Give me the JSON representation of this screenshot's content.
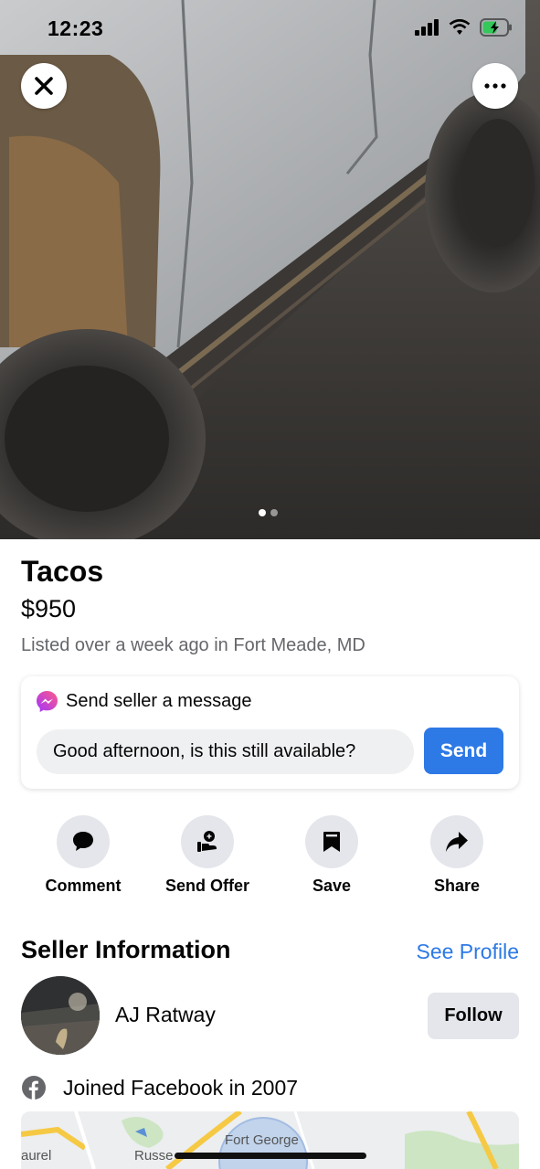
{
  "status": {
    "time": "12:23"
  },
  "listing": {
    "title": "Tacos",
    "price": "$950",
    "meta": "Listed over a week ago in Fort Meade, MD",
    "photo_count": 2,
    "photo_index": 1
  },
  "message": {
    "heading": "Send seller a message",
    "input_value": "Good afternoon, is this still available?",
    "send_label": "Send"
  },
  "actions": [
    {
      "label": "Comment",
      "icon": "comment-icon"
    },
    {
      "label": "Send Offer",
      "icon": "offer-icon"
    },
    {
      "label": "Save",
      "icon": "bookmark-icon"
    },
    {
      "label": "Share",
      "icon": "share-icon"
    }
  ],
  "seller": {
    "heading": "Seller Information",
    "see_profile": "See Profile",
    "name": "AJ Ratway",
    "follow_label": "Follow",
    "joined": "Joined Facebook in 2007"
  },
  "map": {
    "labels": [
      "aurel",
      "Russe",
      "Fort George"
    ]
  },
  "colors": {
    "accent": "#2d79e6",
    "messenger_start": "#a033ff",
    "messenger_end": "#ff5c87",
    "battery": "#34c759"
  }
}
